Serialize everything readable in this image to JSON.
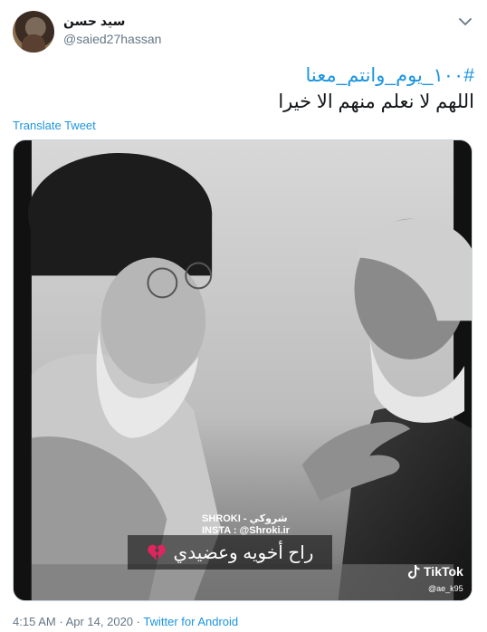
{
  "user": {
    "name": "سيد حسن",
    "handle": "@saied27hassan"
  },
  "tweet": {
    "hashtag": "#١٠٠_يوم_وانتم_معنا",
    "text": "اللهم لا نعلم منهم الا خيرا",
    "translate_label": "Translate Tweet"
  },
  "media": {
    "label_line1": "SHROKI - شروكي",
    "label_line2": "INSTA : @Shroki.ir",
    "caption": "راح أخويه وعضيدي",
    "tiktok_brand": "TikTok",
    "tiktok_handle": "@ae_k95"
  },
  "meta": {
    "time": "4:15 AM",
    "separator": "·",
    "date": "Apr 14, 2020",
    "source": "Twitter for Android"
  },
  "colors": {
    "link": "#1b95e0",
    "secondary_text": "#657786",
    "primary_text": "#14171a",
    "broken_heart": "#e0245e"
  },
  "icons": {
    "more": "chevron-down-icon",
    "caption_emoji": "broken-heart-icon",
    "brand": "tiktok-icon"
  }
}
